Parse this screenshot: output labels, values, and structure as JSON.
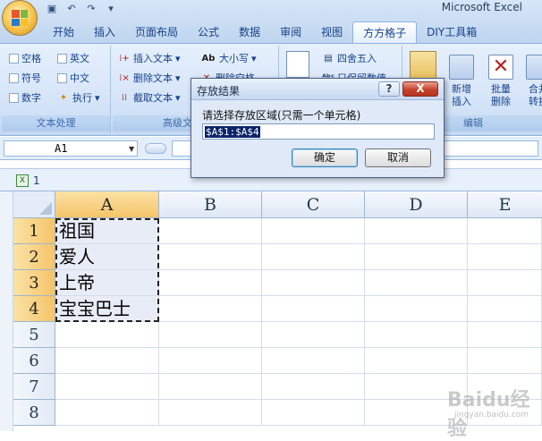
{
  "app": {
    "title": "Microsoft Excel"
  },
  "tabs": [
    "开始",
    "插入",
    "页面布局",
    "公式",
    "数据",
    "审阅",
    "视图",
    "方方格子",
    "DIY工具箱"
  ],
  "active_tab": "方方格子",
  "ribbon": {
    "text_group": {
      "label": "文本处理",
      "checkboxes": [
        "空格",
        "英文",
        "符号",
        "中文",
        "数字"
      ],
      "exec_label": "执行"
    },
    "advanced_group": {
      "label": "高级文",
      "items": [
        "插入文本",
        "删除文本",
        "截取文本",
        "大小写",
        "删除空格"
      ]
    },
    "numeric_group": {
      "items": [
        "四舍五入",
        "只保留数值"
      ]
    },
    "edit_group": {
      "label": "编辑",
      "buttons": [
        {
          "line1": "新增",
          "line2": "插入"
        },
        {
          "line1": "批量",
          "line2": "删除"
        },
        {
          "line1": "合并",
          "line2": "转换"
        }
      ]
    }
  },
  "formula_bar": {
    "name_box": "A1",
    "formula": ""
  },
  "workbook": {
    "name": "1"
  },
  "grid": {
    "columns": [
      "A",
      "B",
      "C",
      "D",
      "E"
    ],
    "rows": [
      "1",
      "2",
      "3",
      "4",
      "5",
      "6",
      "7",
      "8"
    ],
    "cells_a": [
      "祖国",
      "爱人",
      "上帝",
      "宝宝巴士"
    ]
  },
  "dialog": {
    "title": "存放结果",
    "help": "?",
    "close": "X",
    "prompt": "请选择存放区域(只需一个单元格)",
    "input_value": "$A$1:$A$4",
    "ok": "确定",
    "cancel": "取消"
  },
  "watermark": {
    "logo": "Baidu经验",
    "url": "jingyan.baidu.com"
  },
  "colors": {
    "accent": "#15428b",
    "selection_header": "#f5c469",
    "close_red": "#c6412b"
  }
}
